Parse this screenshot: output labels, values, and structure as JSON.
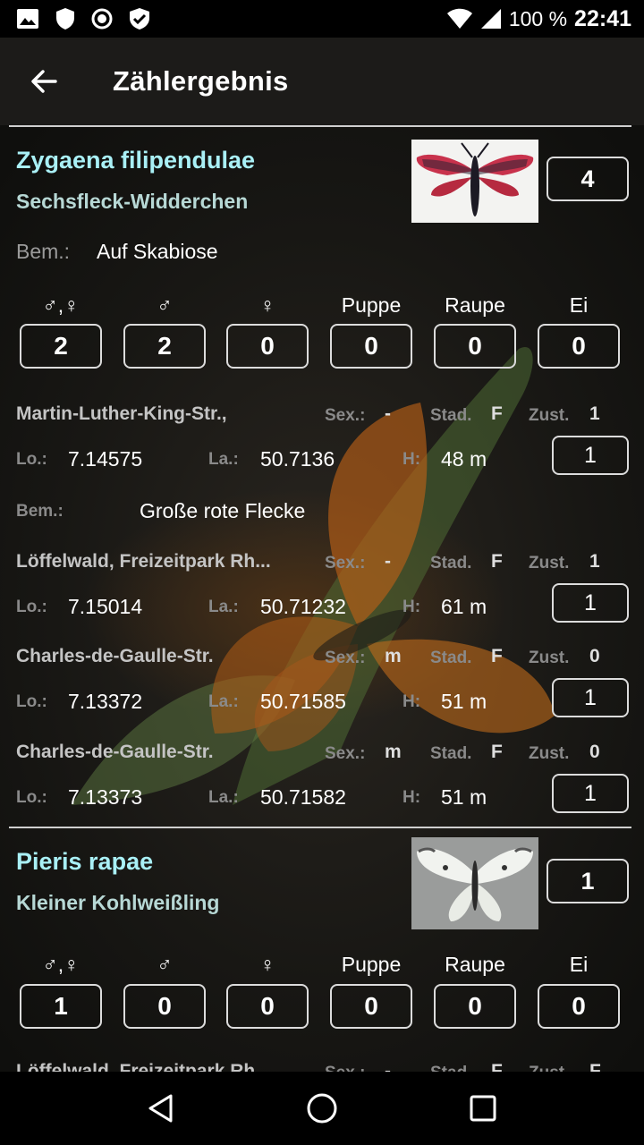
{
  "status_bar": {
    "battery": "100 %",
    "time": "22:41"
  },
  "app_bar": {
    "title": "Zählergebnis"
  },
  "category_labels": [
    "♂,♀",
    "♂",
    "♀",
    "Puppe",
    "Raupe",
    "Ei"
  ],
  "field_labels": {
    "bem": "Bem.:",
    "sex": "Sex.:",
    "stad": "Stad.",
    "zust": "Zust.",
    "lo": "Lo.:",
    "la": "La.:",
    "h": "H:"
  },
  "species": [
    {
      "scientific": "Zygaena filipendulae",
      "common": "Sechsfleck-Widderchen",
      "count": "4",
      "remark": "Auf Skabiose",
      "category_counts": [
        "2",
        "2",
        "0",
        "0",
        "0",
        "0"
      ],
      "records": [
        {
          "location": "Martin-Luther-King-Str.,",
          "sex": "-",
          "stadium": "F",
          "zust": "1",
          "lo": "7.14575",
          "la": "50.7136",
          "h": "48 m",
          "count": "1",
          "remark": "Große rote Flecke"
        },
        {
          "location": "Löffelwald, Freizeitpark Rh...",
          "sex": "-",
          "stadium": "F",
          "zust": "1",
          "lo": "7.15014",
          "la": "50.71232",
          "h": "61 m",
          "count": "1"
        },
        {
          "location": "Charles-de-Gaulle-Str.",
          "sex": "m",
          "stadium": "F",
          "zust": "0",
          "lo": "7.13372",
          "la": "50.71585",
          "h": "51 m",
          "count": "1"
        },
        {
          "location": "Charles-de-Gaulle-Str.",
          "sex": "m",
          "stadium": "F",
          "zust": "0",
          "lo": "7.13373",
          "la": "50.71582",
          "h": "51 m",
          "count": "1"
        }
      ]
    },
    {
      "scientific": "Pieris rapae",
      "common": "Kleiner Kohlweißling",
      "count": "1",
      "category_counts": [
        "1",
        "0",
        "0",
        "0",
        "0",
        "0"
      ],
      "records": [
        {
          "location": "Löffelwald, Freizeitpark Rh...",
          "sex": "-",
          "stadium": "F",
          "zust": "F"
        }
      ]
    }
  ],
  "colors": {
    "scientific_name": "#a9f0f6",
    "common_name": "#b7d8d5",
    "app_bar": "#1c1b19"
  }
}
